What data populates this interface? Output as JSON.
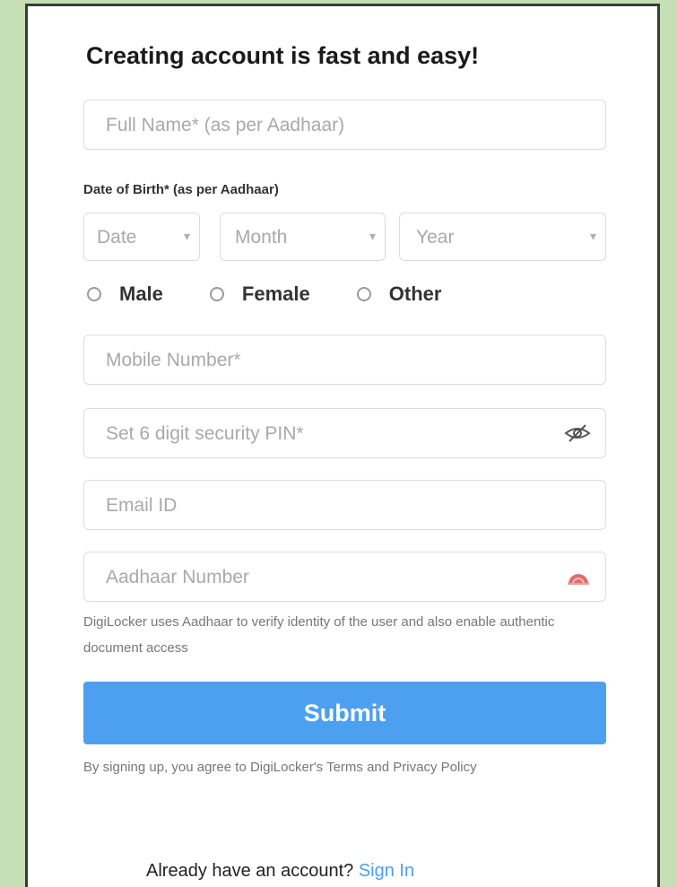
{
  "form": {
    "title": "Creating account is fast and easy!",
    "full_name_placeholder": "Full Name* (as per Aadhaar)",
    "dob_label": "Date of Birth* (as per Aadhaar)",
    "date_placeholder": "Date",
    "month_placeholder": "Month",
    "year_placeholder": "Year",
    "gender_options": [
      "Male",
      "Female",
      "Other"
    ],
    "mobile_placeholder": "Mobile Number*",
    "pin_placeholder": "Set 6 digit security PIN*",
    "email_placeholder": "Email ID",
    "aadhaar_placeholder": "Aadhaar Number",
    "aadhaar_note": "DigiLocker uses Aadhaar to verify identity of the user and also enable authentic document access",
    "submit_label": "Submit",
    "terms_text": "By signing up, you agree to DigiLocker's Terms and Privacy Policy",
    "signin_prompt": "Already have an account?",
    "signin_link": "Sign In"
  },
  "icons": {
    "pin_toggle": "eye-slash-icon",
    "aadhaar": "aadhaar-logo-icon"
  },
  "colors": {
    "background": "#c5deb4",
    "accent": "#4da0f0",
    "aadhaar_icon": "#d9534f"
  }
}
